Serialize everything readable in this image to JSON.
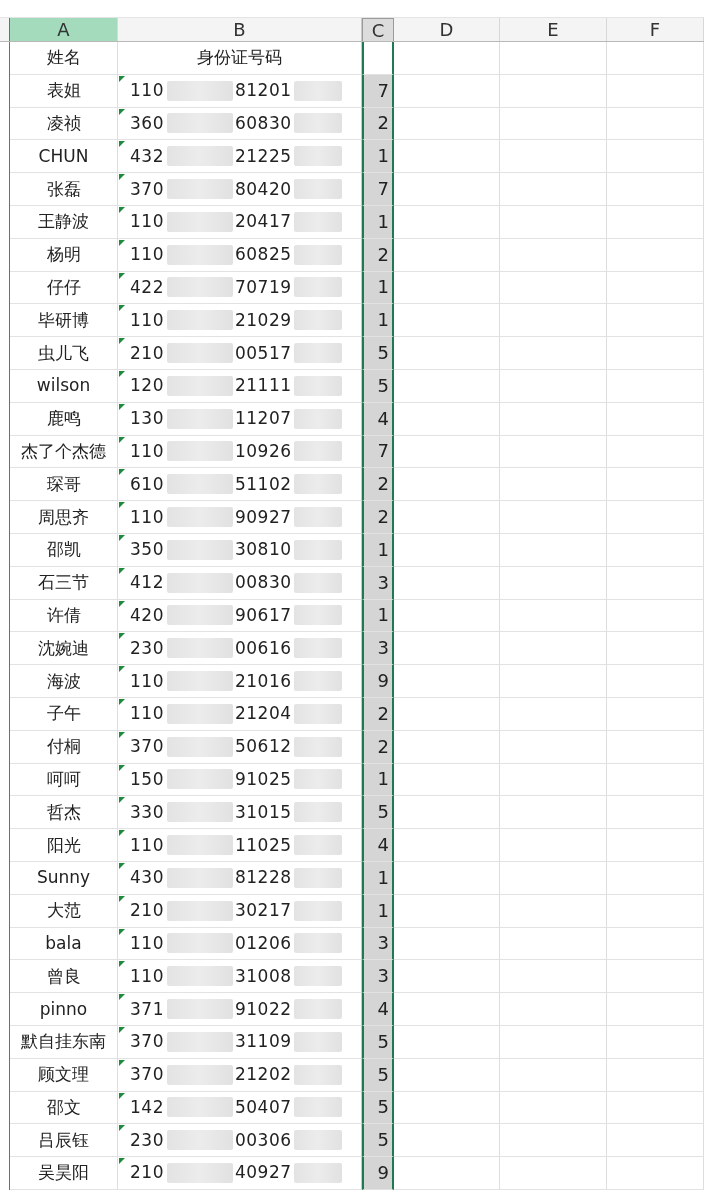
{
  "columns": [
    {
      "label": "A",
      "highlighted": true,
      "selected": false
    },
    {
      "label": "B",
      "highlighted": false,
      "selected": false
    },
    {
      "label": "C",
      "highlighted": false,
      "selected": true
    },
    {
      "label": "D",
      "highlighted": false,
      "selected": false
    },
    {
      "label": "E",
      "highlighted": false,
      "selected": false
    },
    {
      "label": "F",
      "highlighted": false,
      "selected": false
    }
  ],
  "header_row": {
    "name": "姓名",
    "id": "身份证号码"
  },
  "rows": [
    {
      "name": "表姐",
      "id_start": "110",
      "id_mid": "81201",
      "column_c": "7",
      "flagged": true
    },
    {
      "name": "凌祯",
      "id_start": "360",
      "id_mid": "60830",
      "column_c": "2",
      "flagged": true
    },
    {
      "name": "CHUN",
      "id_start": "432",
      "id_mid": "21225",
      "column_c": "1",
      "flagged": true
    },
    {
      "name": "张磊",
      "id_start": "370",
      "id_mid": "80420",
      "column_c": "7",
      "flagged": true
    },
    {
      "name": "王静波",
      "id_start": "110",
      "id_mid": "20417",
      "column_c": "1",
      "flagged": true
    },
    {
      "name": "杨明",
      "id_start": "110",
      "id_mid": "60825",
      "column_c": "2",
      "flagged": true
    },
    {
      "name": "仔仔",
      "id_start": "422",
      "id_mid": "70719",
      "column_c": "1",
      "flagged": true
    },
    {
      "name": "毕研博",
      "id_start": "110",
      "id_mid": "21029",
      "column_c": "1",
      "flagged": true
    },
    {
      "name": "虫儿飞",
      "id_start": "210",
      "id_mid": "00517",
      "column_c": "5",
      "flagged": true
    },
    {
      "name": "wilson",
      "id_start": "120",
      "id_mid": "21111",
      "column_c": "5",
      "flagged": true
    },
    {
      "name": "鹿鸣",
      "id_start": "130",
      "id_mid": "11207",
      "column_c": "4",
      "flagged": true
    },
    {
      "name": "杰了个杰德",
      "id_start": "110",
      "id_mid": "10926",
      "column_c": "7",
      "flagged": true
    },
    {
      "name": "琛哥",
      "id_start": "610",
      "id_mid": "51102",
      "column_c": "2",
      "flagged": true
    },
    {
      "name": "周思齐",
      "id_start": "110",
      "id_mid": "90927",
      "column_c": "2",
      "flagged": true
    },
    {
      "name": "邵凯",
      "id_start": "350",
      "id_mid": "30810",
      "column_c": "1",
      "flagged": true
    },
    {
      "name": "石三节",
      "id_start": "412",
      "id_mid": "00830",
      "column_c": "3",
      "flagged": true
    },
    {
      "name": "许倩",
      "id_start": "420",
      "id_mid": "90617",
      "column_c": "1",
      "flagged": true
    },
    {
      "name": "沈婉迪",
      "id_start": "230",
      "id_mid": "00616",
      "column_c": "3",
      "flagged": true
    },
    {
      "name": "海波",
      "id_start": "110",
      "id_mid": "21016",
      "column_c": "9",
      "flagged": true
    },
    {
      "name": "子午",
      "id_start": "110",
      "id_mid": "21204",
      "column_c": "2",
      "flagged": true
    },
    {
      "name": "付桐",
      "id_start": "370",
      "id_mid": "50612",
      "column_c": "2",
      "flagged": true
    },
    {
      "name": "呵呵",
      "id_start": "150",
      "id_mid": "91025",
      "column_c": "1",
      "flagged": true
    },
    {
      "name": "哲杰",
      "id_start": "330",
      "id_mid": "31015",
      "column_c": "5",
      "flagged": true
    },
    {
      "name": "阳光",
      "id_start": "110",
      "id_mid": "11025",
      "column_c": "4",
      "flagged": true
    },
    {
      "name": "Sunny",
      "id_start": "430",
      "id_mid": "81228",
      "column_c": "1",
      "flagged": true
    },
    {
      "name": "大范",
      "id_start": "210",
      "id_mid": "30217",
      "column_c": "1",
      "flagged": true
    },
    {
      "name": "bala",
      "id_start": "110",
      "id_mid": "01206",
      "column_c": "3",
      "flagged": true
    },
    {
      "name": "曾良",
      "id_start": "110",
      "id_mid": "31008",
      "column_c": "3",
      "flagged": true
    },
    {
      "name": "pinno",
      "id_start": "371",
      "id_mid": "91022",
      "column_c": "4",
      "flagged": true
    },
    {
      "name": "默自挂东南",
      "id_start": "370",
      "id_mid": "31109",
      "column_c": "5",
      "flagged": true
    },
    {
      "name": "顾文理",
      "id_start": "370",
      "id_mid": "21202",
      "column_c": "5",
      "flagged": true
    },
    {
      "name": "邵文",
      "id_start": "142",
      "id_mid": "50407",
      "column_c": "5",
      "flagged": true
    },
    {
      "name": "吕辰钰",
      "id_start": "230",
      "id_mid": "00306",
      "column_c": "5",
      "flagged": true
    },
    {
      "name": "吴昊阳",
      "id_start": "210",
      "id_mid": "40927",
      "column_c": "9",
      "flagged": true
    }
  ]
}
